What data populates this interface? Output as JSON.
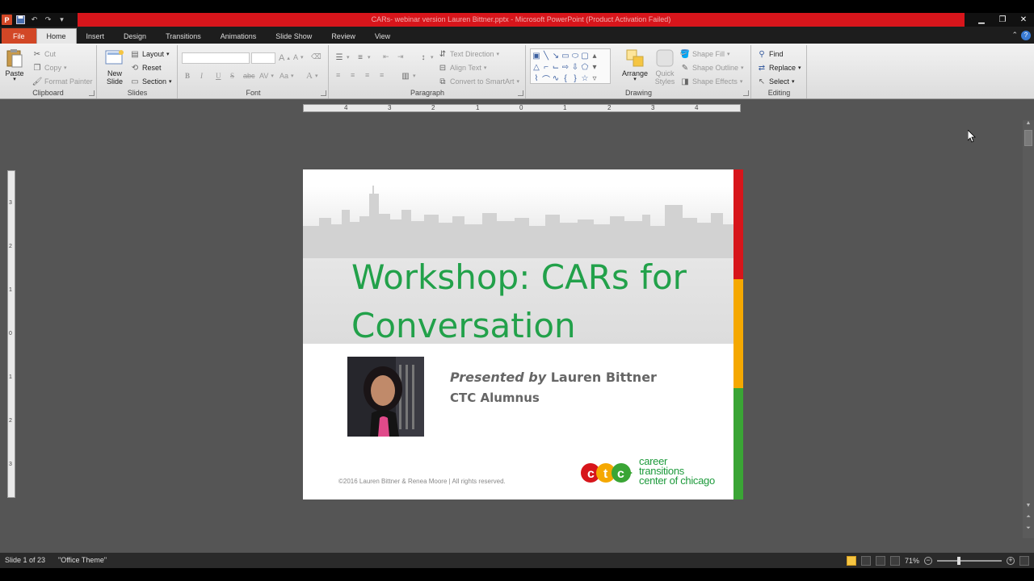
{
  "window": {
    "title": "CARs- webinar version Lauren Bittner.pptx  -  Microsoft PowerPoint (Product Activation Failed)",
    "title_bar_color": "#d7151b"
  },
  "quick_access": {
    "app_icon": "P",
    "icons": [
      "save-icon",
      "undo-icon",
      "redo-icon",
      "customize-icon"
    ]
  },
  "tabs": [
    {
      "label": "File"
    },
    {
      "label": "Home"
    },
    {
      "label": "Insert"
    },
    {
      "label": "Design"
    },
    {
      "label": "Transitions"
    },
    {
      "label": "Animations"
    },
    {
      "label": "Slide Show"
    },
    {
      "label": "Review"
    },
    {
      "label": "View"
    }
  ],
  "ribbon": {
    "clipboard": {
      "label": "Clipboard",
      "paste": "Paste",
      "cut": "Cut",
      "copy": "Copy",
      "format_painter": "Format Painter"
    },
    "slides": {
      "label": "Slides",
      "new_slide": "New Slide",
      "layout": "Layout",
      "reset": "Reset",
      "section": "Section"
    },
    "font": {
      "label": "Font",
      "bold": "B",
      "italic": "I",
      "underline": "U",
      "strike": "S",
      "abc": "abc",
      "av": "AV",
      "aa": "Aa",
      "grow": "A",
      "shrink": "A",
      "color": "A"
    },
    "paragraph": {
      "label": "Paragraph",
      "text_direction": "Text Direction",
      "align_text": "Align Text",
      "convert_smartart": "Convert to SmartArt"
    },
    "drawing": {
      "label": "Drawing",
      "arrange": "Arrange",
      "quick_styles": "Quick Styles",
      "shape_fill": "Shape Fill",
      "shape_outline": "Shape Outline",
      "shape_effects": "Shape Effects"
    },
    "editing": {
      "label": "Editing",
      "find": "Find",
      "replace": "Replace",
      "select": "Select"
    }
  },
  "ruler": {
    "h_ticks": [
      "4",
      "3",
      "2",
      "1",
      "0",
      "1",
      "2",
      "3",
      "4"
    ],
    "v_ticks": [
      "3",
      "2",
      "1",
      "0",
      "1",
      "2",
      "3"
    ]
  },
  "slide": {
    "title_line1": "Workshop: CARs for",
    "title_line2": "Conversation",
    "presented_lead": "Presented by",
    "presenter": "Lauren Bittner",
    "subtitle": "CTC Alumnus",
    "copyright": "©2016  Lauren Bittner & Renea Moore | All rights reserved.",
    "logo_line1": "career",
    "logo_line2": "transitions",
    "logo_line3": "center of chicago",
    "title_color": "#22a14a",
    "stripe_colors": [
      "#d7151b",
      "#f5a800",
      "#3aa535"
    ]
  },
  "status": {
    "slide_info": "Slide 1 of 23",
    "theme": "\"Office Theme\"",
    "zoom": "71%",
    "zoom_level": 0.71
  }
}
